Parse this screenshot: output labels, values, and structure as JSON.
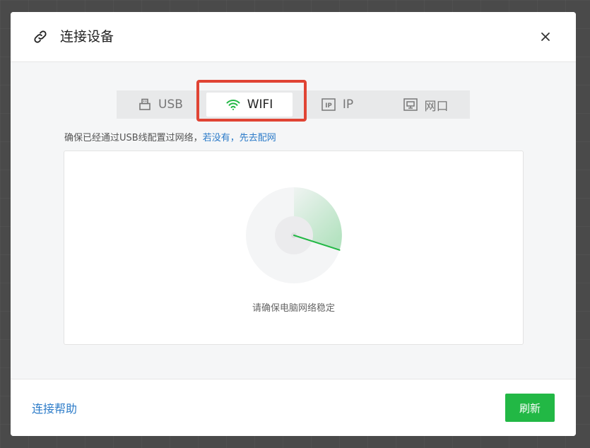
{
  "dialog": {
    "title": "连接设备",
    "icons": {
      "title_icon": "link-icon",
      "close_icon": "close-icon"
    }
  },
  "tabs": [
    {
      "label": "USB",
      "icon": "usb-icon",
      "active": false
    },
    {
      "label": "WIFI",
      "icon": "wifi-icon",
      "active": true
    },
    {
      "label": "IP",
      "icon": "ip-icon",
      "active": false
    },
    {
      "label": "网口",
      "icon": "ethernet-port-icon",
      "active": false
    }
  ],
  "hint": {
    "text": "确保已经通过USB线配置过网络，",
    "link1": "若没有，",
    "link2": "先去配网"
  },
  "scan": {
    "status": "请确保电脑网络稳定"
  },
  "footer": {
    "help_link": "连接帮助",
    "refresh_button": "刷新"
  },
  "colors": {
    "accent_green": "#22b845",
    "link_blue": "#2d7cc9",
    "highlight_red": "#e04434"
  }
}
